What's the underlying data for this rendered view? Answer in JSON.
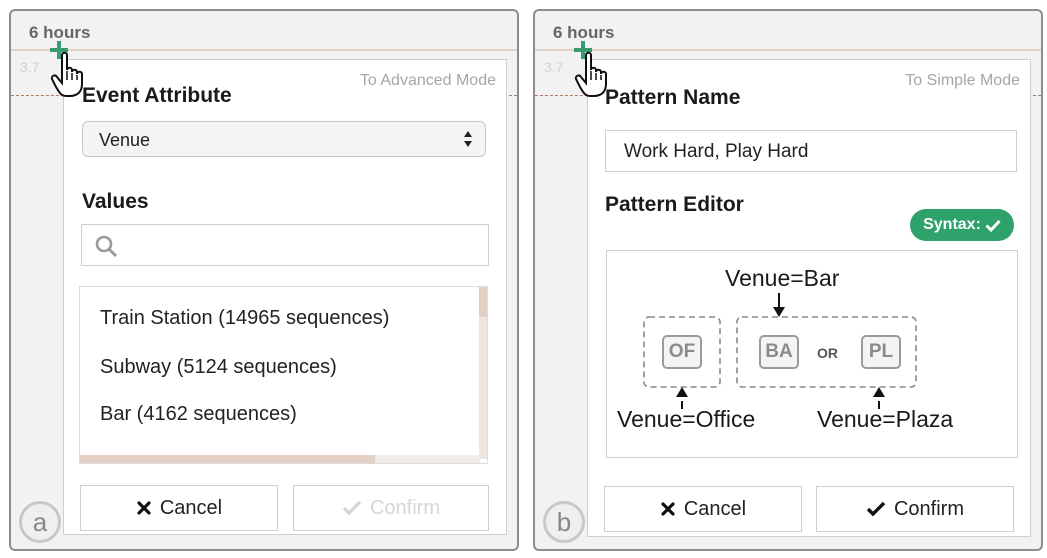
{
  "panel_a": {
    "timeline_label": "6 hours",
    "timeline_value": "3.7",
    "mode_link": "To Advanced Mode",
    "attribute_heading": "Event Attribute",
    "attribute_select": "Venue",
    "values_heading": "Values",
    "search_placeholder": "",
    "values": [
      "Train Station (14965 sequences)",
      "Subway (5124 sequences)",
      "Bar (4162 sequences)"
    ],
    "cancel_label": "Cancel",
    "confirm_label": "Confirm",
    "badge": "a"
  },
  "panel_b": {
    "timeline_label": "6 hours",
    "timeline_value": "3.7",
    "mode_link": "To Simple Mode",
    "name_heading": "Pattern Name",
    "pattern_name": "Work Hard, Play Hard",
    "editor_heading": "Pattern Editor",
    "syntax_label": "Syntax:",
    "chips": {
      "office": "OF",
      "bar": "BA",
      "or": "OR",
      "plaza": "PL"
    },
    "annotations": {
      "bar": "Venue=Bar",
      "office": "Venue=Office",
      "plaza": "Venue=Plaza"
    },
    "cancel_label": "Cancel",
    "confirm_label": "Confirm",
    "badge": "b"
  },
  "colors": {
    "syntax_ok": "#2ea26a",
    "timeline_marker": "#3a9a70"
  }
}
